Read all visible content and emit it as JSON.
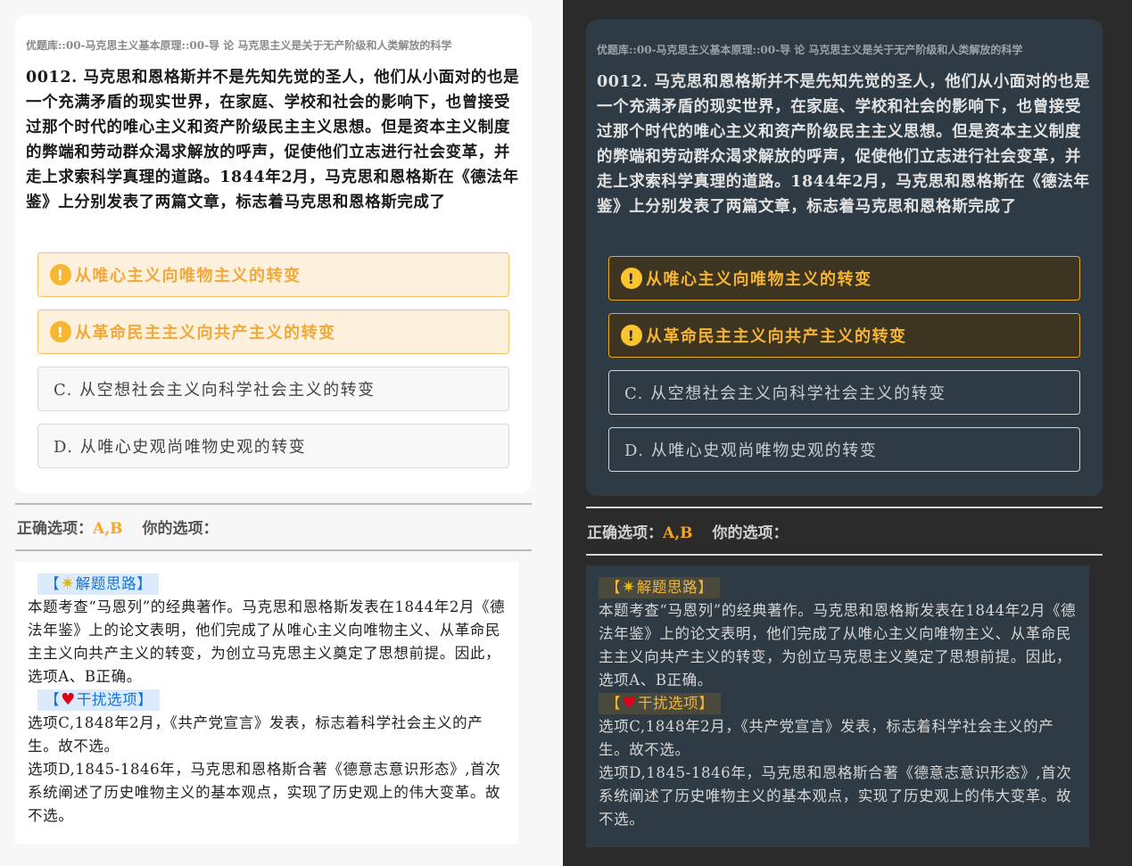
{
  "deck_path": "优题库::00-马克思主义基本原理::00-导 论 马克思主义是关于无产阶级和人类解放的科学",
  "question": "0012. 马克思和恩格斯并不是先知先觉的圣人，他们从小面对的也是一个充满矛盾的现实世界，在家庭、学校和社会的影响下，也曾接受过那个时代的唯心主义和资产阶级民主主义思想。但是资本主义制度的弊端和劳动群众渴求解放的呼声，促使他们立志进行社会变革，并走上求索科学真理的道路。1844年2月，马克思和恩格斯在《德法年鉴》上分别发表了两篇文章，标志着马克思和恩格斯完成了",
  "options": {
    "a": "从唯心主义向唯物主义的转变",
    "b": "从革命民主主义向共产主义的转变",
    "c": "C. 从空想社会主义向科学社会主义的转变",
    "d": "D. 从唯心史观尚唯物史观的转变"
  },
  "warn_glyph": "!",
  "result": {
    "correct_label": "正确选项：",
    "correct_value": "A,B",
    "yours_label": "你的选项："
  },
  "explanation": {
    "tag1_left": "【",
    "tag1_text": "解题思路】",
    "star_glyph": "✷",
    "para1": "本题考查“马恩列”的经典著作。马克思和恩格斯发表在1844年2月《德法年鉴》上的论文表明，他们完成了从唯心主义向唯物主义、从革命民主主义向共产主义的转变，为创立马克思主义奠定了思想前提。因此，选项A、B正确。",
    "tag2_left": "【",
    "tag2_text": "干扰选项】",
    "heart_glyph": "♥",
    "para2": "选项C,1848年2月，《共产党宣言》发表，标志着科学社会主义的产生。故不选。",
    "para3": "选项D,1845-1846年，马克思和恩格斯合著《德意志意识形态》,首次系统阐述了历史唯物主义的基本观点，实现了历史观上的伟大变革。故不选。"
  },
  "colors": {
    "accent": "#f5a623",
    "light_bg": "#f7f7f7",
    "dark_bg": "#2b2b2b",
    "dark_card": "#2e3b44",
    "tag_blue": "#1a73d9"
  },
  "icons": {
    "warning": "exclamation-circle-icon",
    "star": "star-icon",
    "heart": "heart-icon"
  }
}
